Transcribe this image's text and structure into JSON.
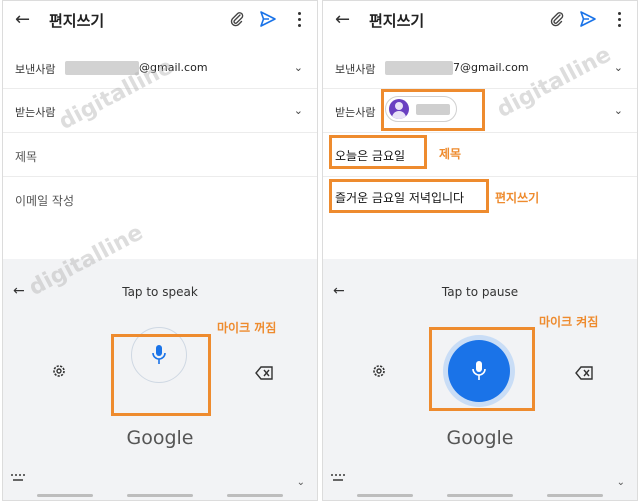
{
  "watermark": "digitalline",
  "panels": {
    "left": {
      "title": "편지쓰기",
      "from_label": "보낸사람",
      "from_email_suffix": "@gmail.com",
      "to_label": "받는사람",
      "subject_placeholder": "제목",
      "body_placeholder": "이메일 작성",
      "voice_prompt": "Tap to speak",
      "brand": "Google",
      "annotation": "마이크 꺼짐"
    },
    "right": {
      "title": "편지쓰기",
      "from_label": "보낸사람",
      "from_email_suffix": "7@gmail.com",
      "to_label": "받는사람",
      "subject_value": "오늘은 금요일",
      "body_value": "즐거운 금요일 저녁입니다",
      "subject_annotation": "제목",
      "body_annotation": "편지쓰기",
      "voice_prompt": "Tap to pause",
      "brand": "Google",
      "annotation": "마이크 켜짐"
    }
  },
  "icons": {
    "back": "arrow-left-icon",
    "attach": "paperclip-icon",
    "send": "send-icon",
    "more": "more-vert-icon",
    "expand": "chevron-down-icon",
    "mic": "microphone-icon",
    "settings": "gear-icon",
    "backspace": "backspace-icon",
    "keyboard": "keyboard-icon"
  },
  "colors": {
    "accent": "#1a73e8",
    "highlight": "#ee8b2e",
    "send": "#1a73e8",
    "avatar": "#6a3fc1"
  }
}
